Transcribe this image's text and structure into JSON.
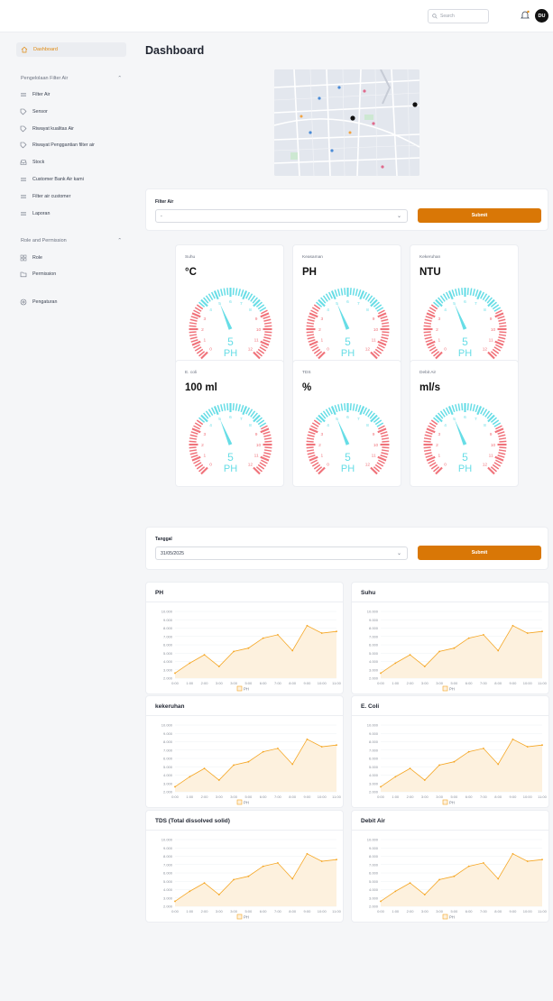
{
  "header": {
    "search_placeholder": "Search",
    "avatar_initials": "DU"
  },
  "sidebar": {
    "active": "Dashboard",
    "section1": {
      "title": "Pengelolaan Filter Air",
      "items": [
        "Filter Air",
        "Sensor",
        "Riwayat kualitas Air",
        "Riwayat Penggantian filter air",
        "Stock",
        "Customer Bank Air kami",
        "Filter air customer",
        "Laporan"
      ]
    },
    "section2": {
      "title": "Role and Permission",
      "items": [
        "Role",
        "Permission"
      ]
    },
    "settings": "Pengaturan"
  },
  "page": {
    "title": "Dashboard"
  },
  "filter_form": {
    "label": "Filter Air",
    "value": "-",
    "submit": "Submit"
  },
  "gauges": [
    {
      "name": "Suhu",
      "unit": "°C",
      "value": 5,
      "label": "PH"
    },
    {
      "name": "Keasaman",
      "unit": "PH",
      "value": 5,
      "label": "PH"
    },
    {
      "name": "Kekeruhan",
      "unit": "NTU",
      "value": 5,
      "label": "PH"
    },
    {
      "name": "E. coli",
      "unit": "100 ml",
      "value": 5,
      "label": "PH"
    },
    {
      "name": "TDS",
      "unit": "%",
      "value": 5,
      "label": "PH"
    },
    {
      "name": "Debit Air",
      "unit": "ml/s",
      "value": 5,
      "label": "PH"
    }
  ],
  "gauge_scale": {
    "min": 0,
    "max": 12,
    "ticks": [
      "0",
      "1",
      "2",
      "3",
      "4",
      "5",
      "6",
      "7",
      "8",
      "9",
      "10",
      "11",
      "12"
    ]
  },
  "date_form": {
    "label": "Tanggal",
    "value": "31/05/2025",
    "submit": "Submit"
  },
  "charts": [
    {
      "title": "PH"
    },
    {
      "title": "Suhu"
    },
    {
      "title": "kekeruhan"
    },
    {
      "title": "E. Coli"
    },
    {
      "title": "TDS (Total dissolved solid)"
    },
    {
      "title": "Debit Air"
    }
  ],
  "chart_data": {
    "type": "area",
    "categories": [
      "0:00",
      "1:00",
      "2:00",
      "3:00",
      "3:00",
      "5:00",
      "6:00",
      "7:00",
      "8:00",
      "9:00",
      "10:00",
      "11:00"
    ],
    "series": [
      {
        "name": "PH",
        "values": [
          2.6,
          3.8,
          4.8,
          3.4,
          5.2,
          5.6,
          6.8,
          7.2,
          5.3,
          8.3,
          7.4,
          7.6
        ]
      }
    ],
    "yticks": [
      "2.000",
      "3.000",
      "4.000",
      "5.000",
      "6.000",
      "7.000",
      "8.000",
      "9.000",
      "10.000"
    ],
    "ylim": [
      2,
      10
    ],
    "colors": {
      "line": "#f5a623",
      "fill": "#fdf1de"
    }
  },
  "colors": {
    "accent": "#d97706",
    "gauge_red": "#f0727a",
    "gauge_cyan": "#67dde6"
  }
}
